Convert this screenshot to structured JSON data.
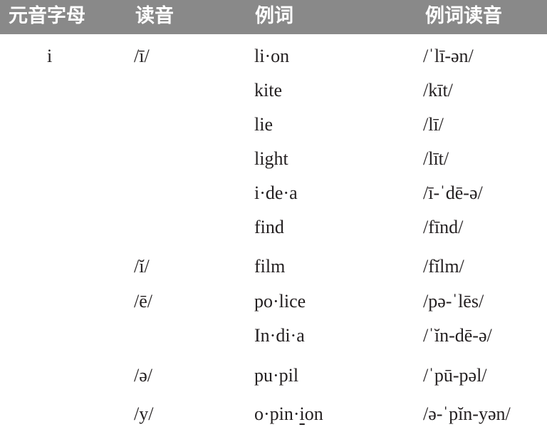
{
  "table": {
    "headers": {
      "letter": "元音字母",
      "reading": "读音",
      "example": "例词",
      "pronunciation": "例词读音"
    },
    "rows": [
      {
        "letter": "i",
        "reading": "/ī/",
        "example": "li·on",
        "pronunciation": "/ˈlī-ən/"
      },
      {
        "letter": "",
        "reading": "",
        "example": "kite",
        "pronunciation": "/kīt/"
      },
      {
        "letter": "",
        "reading": "",
        "example": "lie",
        "pronunciation": "/lī/"
      },
      {
        "letter": "",
        "reading": "",
        "example": "light",
        "pronunciation": "/līt/"
      },
      {
        "letter": "",
        "reading": "",
        "example": "i·de·a",
        "pronunciation": "/ī-ˈdē-ə/"
      },
      {
        "letter": "",
        "reading": "",
        "example": "find",
        "pronunciation": "/fīnd/"
      },
      {
        "letter": "",
        "reading": "/ĭ/",
        "example": "film",
        "pronunciation": "/fĭlm/"
      },
      {
        "letter": "",
        "reading": "/ē/",
        "example": "po·lice",
        "pronunciation": "/pə-ˈlēs/"
      },
      {
        "letter": "",
        "reading": "",
        "example": "In·di·a",
        "pronunciation": "/ˈĭn-dē-ə/"
      },
      {
        "letter": "",
        "reading": "/ə/",
        "example": "pu·pil",
        "pronunciation": "/ˈpū-pəl/"
      },
      {
        "letter": "",
        "reading": "/y/",
        "example": "o·pin·ion",
        "pronunciation": "/ə-ˈpĭn-yən/"
      }
    ],
    "last_example_parts": {
      "before": "o·pin·",
      "underlined": "i",
      "after": "on"
    }
  }
}
